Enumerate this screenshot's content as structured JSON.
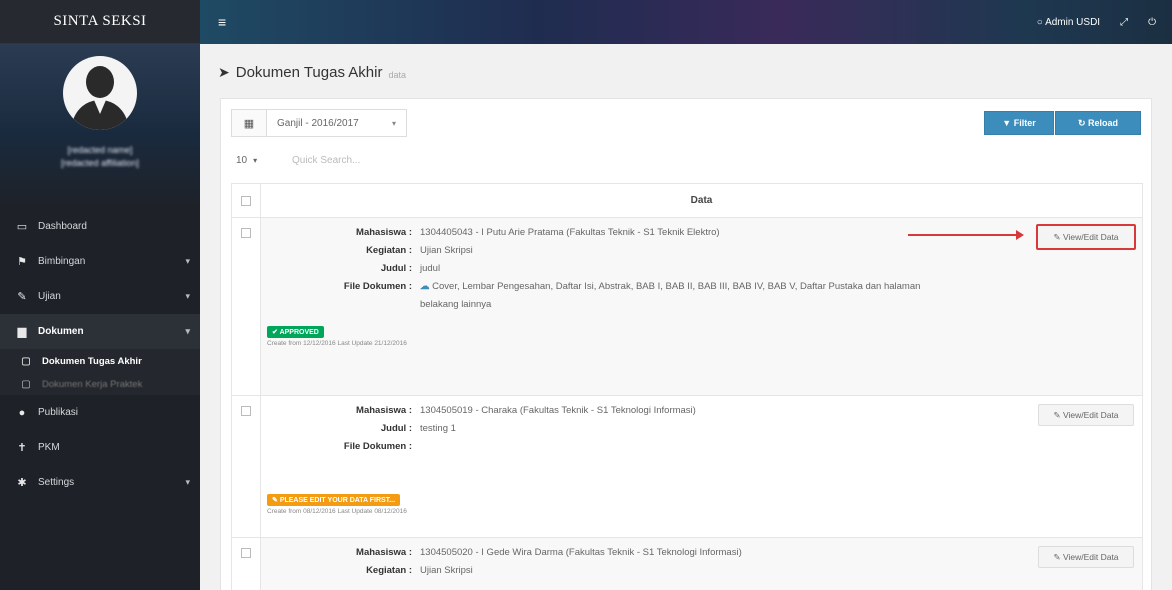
{
  "sidebar": {
    "brand": "SINTA SEKSI",
    "profile": {
      "name": "[redacted name]",
      "subtitle": "[redacted affiliation]"
    },
    "menu": [
      {
        "label": "Dashboard",
        "icon": "monitor-icon",
        "chevron": false
      },
      {
        "label": "Bimbingan",
        "icon": "flag-icon",
        "chevron": true
      },
      {
        "label": "Ujian",
        "icon": "pin-icon",
        "chevron": true
      },
      {
        "label": "Dokumen",
        "icon": "folder-icon",
        "chevron": true,
        "active": true
      },
      {
        "label": "Publikasi",
        "icon": "globe-icon",
        "chevron": false
      },
      {
        "label": "PKM",
        "icon": "trophy-icon",
        "chevron": false
      },
      {
        "label": "Settings",
        "icon": "cogs-icon",
        "chevron": true
      }
    ],
    "submenu": [
      {
        "label": "Dokumen Tugas Akhir",
        "current": true
      },
      {
        "label": "Dokumen Kerja Praktek",
        "current": false
      }
    ]
  },
  "topbar": {
    "user": "Admin USDI"
  },
  "page": {
    "title": "Dokumen Tugas Akhir",
    "subtitle": "data"
  },
  "toolbar": {
    "semester": "Ganjil - 2016/2017",
    "filter_label": "Filter",
    "reload_label": "Reload",
    "page_size": "10",
    "search_placeholder": "Quick Search..."
  },
  "grid": {
    "header": "Data",
    "edit_label": "View/Edit Data",
    "rows": [
      {
        "mahasiswa": "1304405043 - I Putu Arie Pratama (Fakultas Teknik - S1 Teknik Elektro)",
        "kegiatan": "Ujian Skripsi",
        "judul": "judul",
        "file_line1": "Cover, Lembar Pengesahan, Daftar Isi, Abstrak, BAB I, BAB II, BAB III, BAB IV, BAB V, Daftar Pustaka dan halaman",
        "file_line2": "belakang lainnya",
        "status": "APPROVED",
        "meta": "Create from 12/12/2016  Last Update 21/12/2016"
      },
      {
        "mahasiswa": "1304505019 - Charaka (Fakultas Teknik - S1 Teknologi Informasi)",
        "judul": "testing 1",
        "status": "PLEASE EDIT YOUR DATA FIRST...",
        "meta": "Create from 08/12/2016  Last Update 08/12/2016"
      },
      {
        "mahasiswa": "1304505020 - I Gede Wira Darma (Fakultas Teknik - S1 Teknologi Informasi)",
        "kegiatan": "Ujian Skripsi"
      }
    ]
  },
  "labels": {
    "mahasiswa": "Mahasiswa :",
    "kegiatan": "Kegiatan :",
    "judul": "Judul :",
    "file": "File Dokumen :"
  },
  "colors": {
    "accent": "#3c8dbc",
    "approved": "#00a65a",
    "pending": "#f39c12",
    "highlight": "#d9383a"
  }
}
